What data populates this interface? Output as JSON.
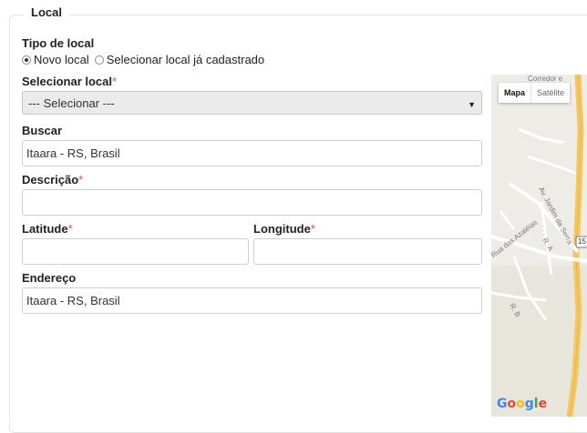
{
  "fieldset": {
    "legend": "Local"
  },
  "tipo_local": {
    "label": "Tipo de local",
    "options": [
      {
        "label": "Novo local",
        "checked": true
      },
      {
        "label": "Selecionar local já cadastrado",
        "checked": false
      }
    ]
  },
  "selecionar_local": {
    "label": "Selecionar local",
    "required_mark": "*",
    "value": "--- Selecionar ---"
  },
  "buscar": {
    "label": "Buscar",
    "value": "Itaara - RS, Brasil"
  },
  "descricao": {
    "label": "Descrição",
    "required_mark": "*",
    "value": ""
  },
  "latitude": {
    "label": "Latitude",
    "required_mark": "*",
    "value": ""
  },
  "longitude": {
    "label": "Longitude",
    "required_mark": "*",
    "value": ""
  },
  "endereco": {
    "label": "Endereço",
    "value": "Itaara - RS, Brasil"
  },
  "map": {
    "tabs": [
      {
        "label": "Mapa",
        "active": true
      },
      {
        "label": "Satélite",
        "active": false
      }
    ],
    "street_labels": [
      "Corredor e",
      "Av. Jardim da Serra",
      "Rua das Azaléias",
      "R. A",
      "R. B",
      "15"
    ],
    "logo": "Google",
    "logo_colors": [
      "#4285F4",
      "#EA4335",
      "#FBBC05",
      "#4285F4",
      "#34A853",
      "#EA4335"
    ]
  }
}
